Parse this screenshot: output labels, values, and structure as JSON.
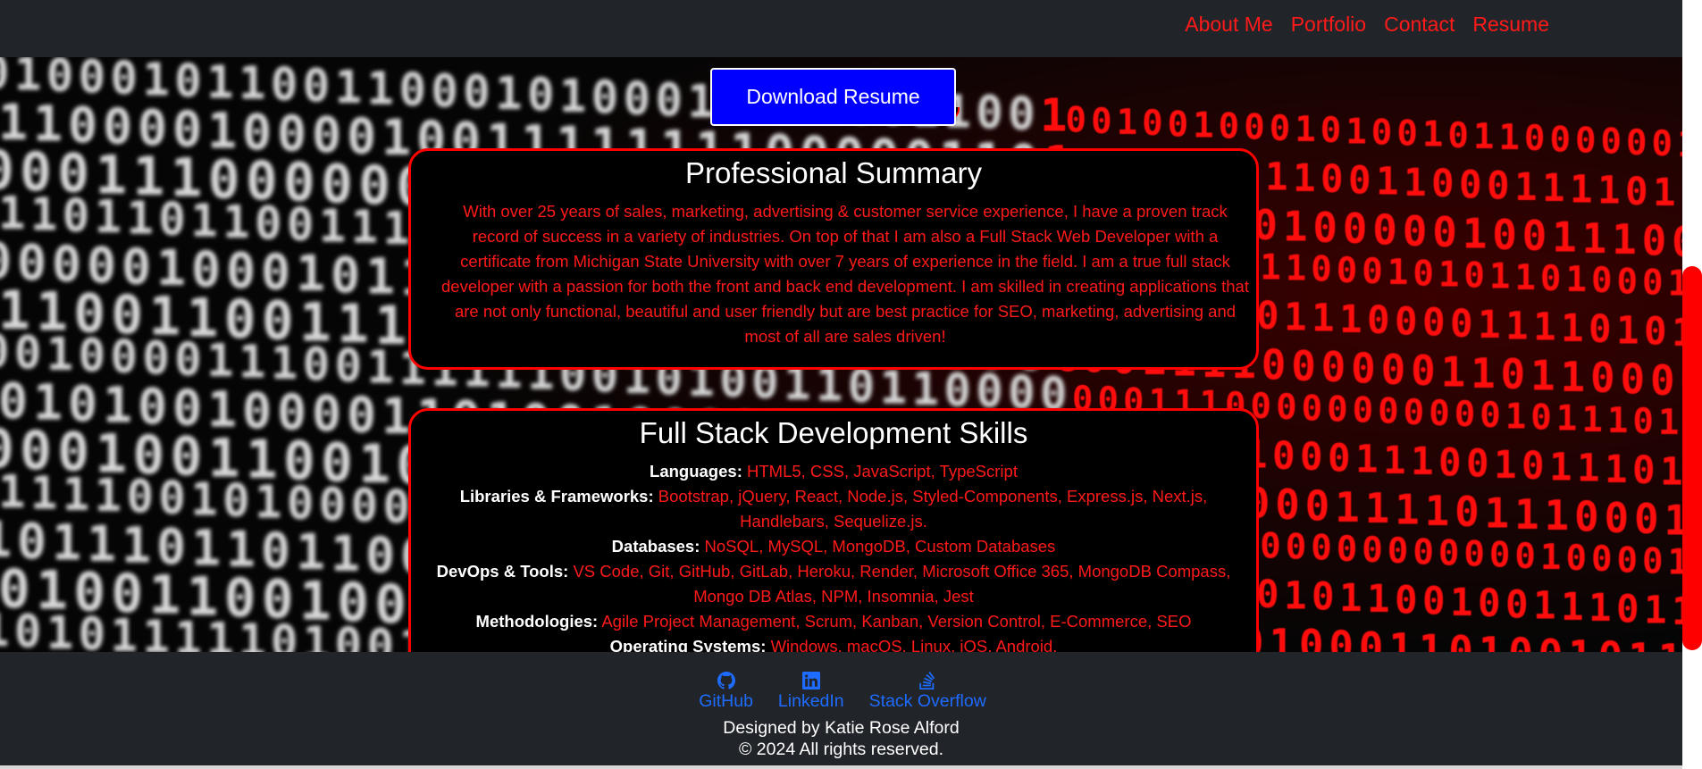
{
  "nav": {
    "items": [
      {
        "label": "About Me"
      },
      {
        "label": "Portfolio"
      },
      {
        "label": "Contact"
      },
      {
        "label": "Resume"
      }
    ]
  },
  "download": {
    "label": "Download Resume"
  },
  "summary": {
    "title": "Professional Summary",
    "text": "With over 25 years of sales, marketing, advertising & customer service experience, I have a proven track record of success in a variety of industries. On top of that I am also a Full Stack Web Developer with a certificate from Michigan State University with over 7 years of experience in the field. I am a true full stack developer with a passion for both the front and back end development. I am skilled in creating applications that are not only functional, beautiful and user friendly but are best practice for SEO, marketing, advertising and most of all are sales driven!"
  },
  "skills": {
    "title": "Full Stack Development Skills",
    "rows": [
      {
        "label": "Languages:",
        "value": "HTML5, CSS, JavaScript, TypeScript"
      },
      {
        "label": "Libraries & Frameworks:",
        "value": "Bootstrap, jQuery, React, Node.js, Styled-Components, Express.js, Next.js, Handlebars, Sequelize.js."
      },
      {
        "label": "Databases:",
        "value": "NoSQL, MySQL, MongoDB, Custom Databases"
      },
      {
        "label": "DevOps & Tools:",
        "value": "VS Code, Git, GitHub, GitLab, Heroku, Render, Microsoft Office 365, MongoDB Compass, Mongo DB Atlas, NPM, Insomnia, Jest"
      },
      {
        "label": "Methodologies:",
        "value": "Agile Project Management, Scrum, Kanban, Version Control, E-Commerce, SEO"
      },
      {
        "label": "Operating Systems:",
        "value": "Windows, macOS, Linux, iOS, Android."
      }
    ]
  },
  "footer": {
    "links": [
      {
        "label": "GitHub",
        "icon": "github-icon"
      },
      {
        "label": "LinkedIn",
        "icon": "linkedin-icon"
      },
      {
        "label": "Stack Overflow",
        "icon": "stack-overflow-icon"
      }
    ],
    "designed": "Designed by Katie Rose Alford",
    "copyright": "© 2024 All rights reserved."
  },
  "colors": {
    "accent": "#ff0000",
    "nav_bg": "#212529",
    "button_bg": "#0000ff",
    "footer_link": "#1e6bff",
    "scroll_thumb": "#ff0000"
  }
}
